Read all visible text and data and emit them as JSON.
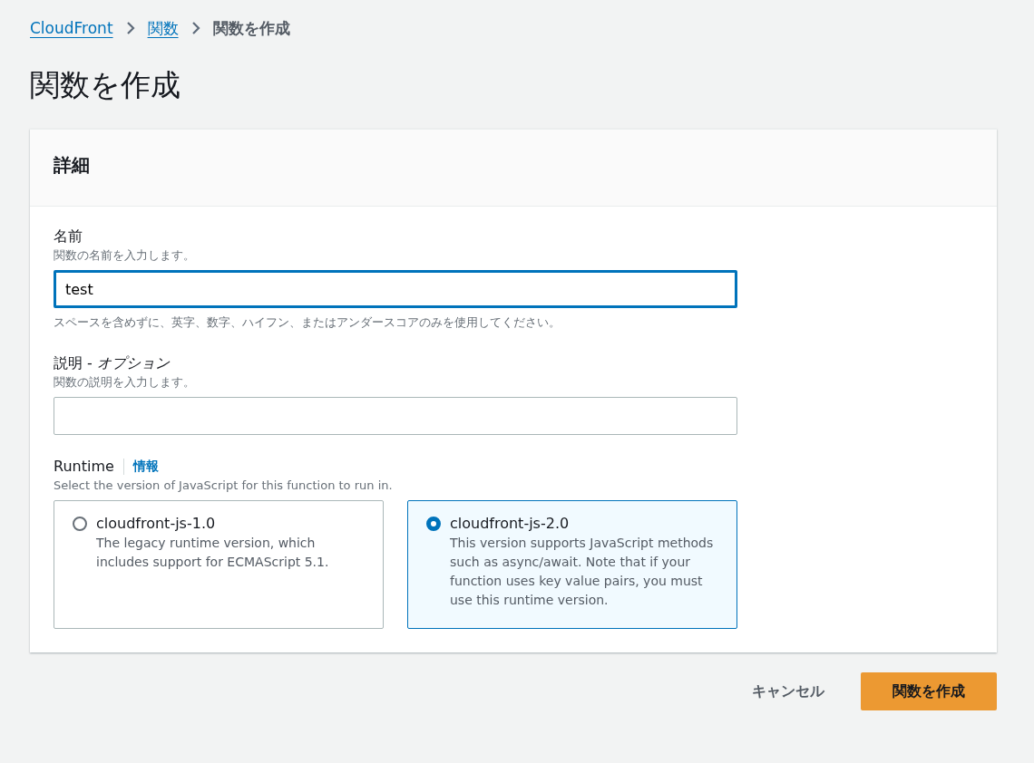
{
  "breadcrumb": [
    {
      "label": "CloudFront",
      "kind": "link"
    },
    {
      "label": "関数",
      "kind": "link"
    },
    {
      "label": "関数を作成",
      "kind": "current"
    }
  ],
  "page_title": "関数を作成",
  "panel": {
    "title": "詳細",
    "name_field": {
      "label": "名前",
      "description": "関数の名前を入力します。",
      "value": "test",
      "focused": true,
      "constraint": "スペースを含めずに、英字、数字、ハイフン、またはアンダースコアのみを使用してください。"
    },
    "description_field": {
      "label": "説明 - *オプション*",
      "description": "関数の説明を入力します。",
      "focused": false
    },
    "runtime": {
      "label": "Runtime",
      "info_link": "情報",
      "description": "Select the version of JavaScript for this function to run in.",
      "options": [
        {
          "label": "cloudfront-js-1.0",
          "description": "The legacy runtime version, which includes support for ECMAScript 5.1.",
          "selected": false
        },
        {
          "label": "cloudfront-js-2.0",
          "description": "This version supports JavaScript methods such as async/await. Note that if your function uses key value pairs, you must use this runtime version.",
          "selected": true
        }
      ]
    }
  },
  "buttons": {
    "cancel": "キャンセル",
    "submit": "関数を作成"
  }
}
